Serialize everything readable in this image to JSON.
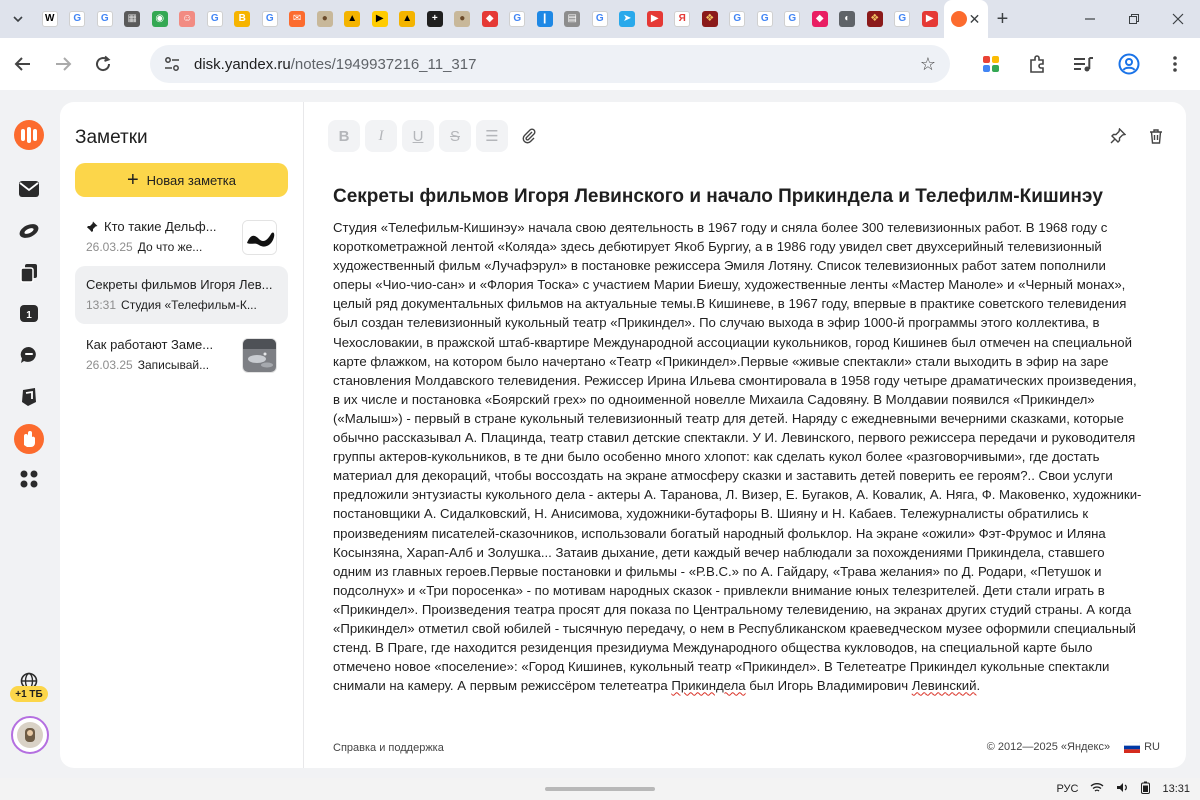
{
  "browser": {
    "tabs": [
      {
        "icon": "expand-tabs-icon"
      },
      {
        "label": "W",
        "color": "#ffffff",
        "fg": "#000000"
      },
      {
        "label": "G",
        "color": "#ffffff",
        "fg": "#4285f4"
      },
      {
        "label": "G",
        "color": "#ffffff",
        "fg": "#4285f4"
      },
      {
        "label": "▦",
        "color": "#5a5a5a",
        "fg": "#dddddd"
      },
      {
        "label": "◉",
        "color": "#34a853",
        "fg": "#ffffff"
      },
      {
        "label": "☺",
        "color": "#f28b82",
        "fg": "#ffffff"
      },
      {
        "label": "G",
        "color": "#ffffff",
        "fg": "#4285f4"
      },
      {
        "label": "B",
        "color": "#f6b400",
        "fg": "#ffffff"
      },
      {
        "label": "G",
        "color": "#ffffff",
        "fg": "#4285f4"
      },
      {
        "label": "✉",
        "color": "#fc6b2e",
        "fg": "#ffffff"
      },
      {
        "label": "●",
        "color": "#c8b89a",
        "fg": "#6b4a2a"
      },
      {
        "label": "▲",
        "color": "#f4b400",
        "fg": "#000000"
      },
      {
        "label": "▶",
        "color": "#ffcc00",
        "fg": "#000000"
      },
      {
        "label": "▲",
        "color": "#f4b400",
        "fg": "#000000"
      },
      {
        "label": "+",
        "color": "#1f1f1f",
        "fg": "#ffffff"
      },
      {
        "label": "●",
        "color": "#c8b89a",
        "fg": "#6b4a2a"
      },
      {
        "label": "◆",
        "color": "#e53935",
        "fg": "#ffffff"
      },
      {
        "label": "G",
        "color": "#ffffff",
        "fg": "#4285f4"
      },
      {
        "label": "❙",
        "color": "#1e88e5",
        "fg": "#ffffff"
      },
      {
        "label": "▤",
        "color": "#8d8d8d",
        "fg": "#ffffff"
      },
      {
        "label": "G",
        "color": "#ffffff",
        "fg": "#4285f4"
      },
      {
        "label": "➤",
        "color": "#29a9eb",
        "fg": "#ffffff"
      },
      {
        "label": "▶",
        "color": "#e53935",
        "fg": "#ffffff"
      },
      {
        "label": "Я",
        "color": "#ffffff",
        "fg": "#e53935"
      },
      {
        "label": "❖",
        "color": "#8b1a1a",
        "fg": "#f0c060"
      },
      {
        "label": "G",
        "color": "#ffffff",
        "fg": "#4285f4"
      },
      {
        "label": "G",
        "color": "#ffffff",
        "fg": "#4285f4"
      },
      {
        "label": "G",
        "color": "#ffffff",
        "fg": "#4285f4"
      },
      {
        "label": "◆",
        "color": "#e91e63",
        "fg": "#ffffff"
      },
      {
        "label": "◐",
        "color": "#5f6368",
        "fg": "#ffffff"
      },
      {
        "label": "❖",
        "color": "#8b1a1a",
        "fg": "#f0c060"
      },
      {
        "label": "G",
        "color": "#ffffff",
        "fg": "#4285f4"
      },
      {
        "label": "▶",
        "color": "#e53935",
        "fg": "#ffffff"
      }
    ],
    "active_tab_icon": "yandex-disk-icon",
    "new_tab_label": "+",
    "url_host": "disk.yandex.ru",
    "url_path": "/notes/1949937216_11_317"
  },
  "rail": {
    "icons": [
      "yandex-360-logo-icon",
      "mail-icon",
      "disk-icon",
      "files-icon",
      "calendar-icon",
      "messenger-icon",
      "telemost-icon",
      "notes-icon",
      "apps-icon"
    ],
    "storage_badge": "+1 ТБ"
  },
  "sidebar": {
    "title": "Заметки",
    "new_note_label": "Новая заметка",
    "notes": [
      {
        "title": "Кто такие Дельф...",
        "date": "26.03.25",
        "snippet": "До что же...",
        "pinned": true
      },
      {
        "title": "Секреты фильмов Игоря Лев...",
        "date": "13:31",
        "snippet": "Студия «Телефильм-К...",
        "pinned": false
      },
      {
        "title": "Как работают Заме...",
        "date": "26.03.25",
        "snippet": "Записывай...",
        "pinned": false
      }
    ]
  },
  "editor": {
    "format_buttons": [
      "B",
      "I",
      "U",
      "S",
      "☰"
    ],
    "heading": "Секреты фильмов Игоря Левинского и начало Прикиндела и Телефилм-Кишинэу",
    "body_main": " Студия «Телефильм-Кишинэу» начала свою деятельность в 1967 году и сняла более 300 телевизионных работ. В 1968 году с короткометражной лентой «Коляда» здесь дебютирует Якоб Бургиу, а в 1986 году увидел свет двухсерийный телевизионный художественный фильм «Лучафэрул» в постановке режиссера Эмиля Лотяну. Список телевизионных работ затем пополнили оперы «Чио-чио-сан» и «Флория Тоска» с участием Марии Биешу, художественные ленты «Мастер Маноле» и «Черный монах», целый ряд документальных фильмов на актуальные темы.В Кишиневе, в 1967 году, впервые в практике советского телевидения был создан телевизионный кукольный театр «Прикиндел». По случаю выхода в эфир 1000-й программы этого коллектива, в Чехословакии, в пражской штаб-квартире Международной ассоциации кукольников, город Кишинев был отмечен на специальной карте флажком, на котором было начертано «Театр «Прикиндел».Первые «живые спектакли» стали выходить в эфир на заре становления Молдавского телевидения. Режиссер Ирина Ильева смонтировала в 1958 году четыре драматических произведения, в их числе и постановка «Боярский грех» по одноименной новелле Михаила Садовяну. В Молдавии появился «Прикиндел» («Малыш») - первый в стране кукольный телевизионный театр для детей. Наряду с ежедневными вечерними сказками, которые обычно рассказывал А. Плацинда, театр ставил детские спектакли. У И. Левинского, первого режиссера передачи и руководителя группы актеров-кукольников, в те дни было особенно много хлопот: как сделать кукол более «разговорчивыми», где достать материал для декораций, чтобы воссоздать на экране атмосферу сказки и заставить детей поверить ее героям?.. Свои услуги предложили энтузиасты кукольного дела - актеры А. Таранова, Л. Визер, Е. Бугаков, А. Ковалик, А. Няга, Ф. Маковенко, художники-постановщики А. Сидалковский, Н. Анисимова, художники-бутафоры В. Шияну и Н. Кабаев. Тележурналисты обратились к произведениям писателей-сказочников, использовали богатый народный фольклор. На экране «ожили» Фэт-Фрумос и Иляна Косынзяна, Харап-Алб и Золушка... Затаив дыхание, дети каждый вечер наблюдали за похождениями Прикиндела, ставшего одним из главных героев.Первые постановки и фильмы - «Р.В.С.» по А. Гайдару, «Трава желания» по Д. Родари, «Петушок и подсолнух» и «Три поросенка» - по мотивам народных сказок - привлекли внимание юных телезрителей. Дети стали играть в «Прикиндел». Произведения театра просят для показа по Центральному телевидению, на экранах других студий страны. А когда «Прикиндел» отметил свой юбилей - тысячную передачу, о нем в Республиканском краеведческом музее оформили специальный стенд. В Праге, где находится резиденция президиума Международного общества кукловодов, на специальной карте было отмечено новое «поселение»: «Город Кишинев, кукольный театр «Прикиндел». В Телетеатре Прикиндел кукольные спектакли снимали на камеру. А первым режиссёром телетеатра ",
    "body_word_1": "Прикиндела",
    "body_mid": " был Игорь Владимирович ",
    "body_word_2": "Левинский",
    "body_end": "."
  },
  "footer": {
    "help_link": "Справка и поддержка",
    "copyright": "© 2012—2025 «Яндекс»",
    "lang": "RU"
  },
  "taskbar": {
    "lang": "РУС",
    "time": "13:31"
  },
  "colors": {
    "accent_yellow": "#fcd64a",
    "brand_orange": "#fc6b2e"
  }
}
